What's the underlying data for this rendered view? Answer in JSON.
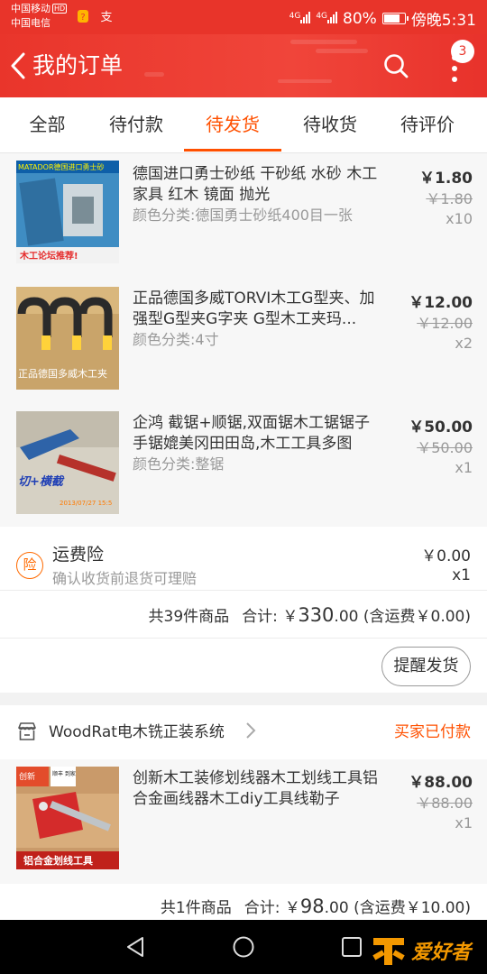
{
  "status_bar": {
    "carrier1": "中国移动",
    "carrier1_badge": "HD",
    "carrier2": "中国电信",
    "net1": "4G",
    "net2": "4G",
    "battery_text": "80%",
    "battery_level": 0.8,
    "time": "傍晚5:31"
  },
  "header": {
    "title": "我的订单",
    "badge_count": "3",
    "color": "#e8342a"
  },
  "tabs": [
    {
      "label": "全部"
    },
    {
      "label": "待付款"
    },
    {
      "label": "待发货",
      "active": true
    },
    {
      "label": "待收货"
    },
    {
      "label": "待评价"
    }
  ],
  "accent_color": "#ff5000",
  "order1": {
    "items": [
      {
        "title": "德国进口勇士砂纸 干砂纸 水砂 木工  家具 红木 镜面 抛光",
        "spec": "颜色分类:德国勇士砂纸400目一张",
        "price": "￥1.80",
        "orig_price": "￥1.80",
        "qty": "x10",
        "thumb_caption": "木工论坛推荐!",
        "thumb_brand": "MATADOR德国进口勇士砂"
      },
      {
        "title": "正品德国多威TORVI木工G型夹、加强型G型夹G字夹 G型木工夹玛...",
        "spec": "颜色分类:4寸",
        "price": "￥12.00",
        "orig_price": "￥12.00",
        "qty": "x2",
        "thumb_caption": "正品德国多威木工夹"
      },
      {
        "title": "企鸿 截锯+顺锯,双面锯木工锯锯子手锯媲美冈田田岛,木工工具多图",
        "spec": "颜色分类:整锯",
        "price": "￥50.00",
        "orig_price": "￥50.00",
        "qty": "x1",
        "thumb_caption": "切+横截",
        "thumb_date": "2013/07/27 15:5"
      }
    ],
    "insurance": {
      "icon_char": "险",
      "title": "运费险",
      "subtitle": "确认收货前退货可理赔",
      "price": "￥0.00",
      "qty": "x1"
    },
    "summary": {
      "count_text": "共39件商品",
      "total_label": "合计: ￥",
      "total_big": "330",
      "total_small": ".00",
      "shipping": "(含运费￥0.00)"
    },
    "remind_button": "提醒发货"
  },
  "order2": {
    "store_name": "WoodRat电木铣正装系统",
    "status": "买家已付款",
    "items": [
      {
        "title": "创新木工装修划线器木工划线工具铝合金画线器木工diy工具线勒子",
        "spec": "",
        "price": "￥88.00",
        "orig_price": "￥88.00",
        "qty": "x1",
        "thumb_caption": "铝合金划线工具",
        "thumb_badge": "创新",
        "thumb_badge2": "顺丰 到家"
      }
    ],
    "summary": {
      "count_text": "共1件商品",
      "total_label": "合计: ￥",
      "total_big": "98",
      "total_small": ".00",
      "shipping": "(含运费￥10.00)"
    }
  },
  "watermark": {
    "text": "爱好者"
  }
}
